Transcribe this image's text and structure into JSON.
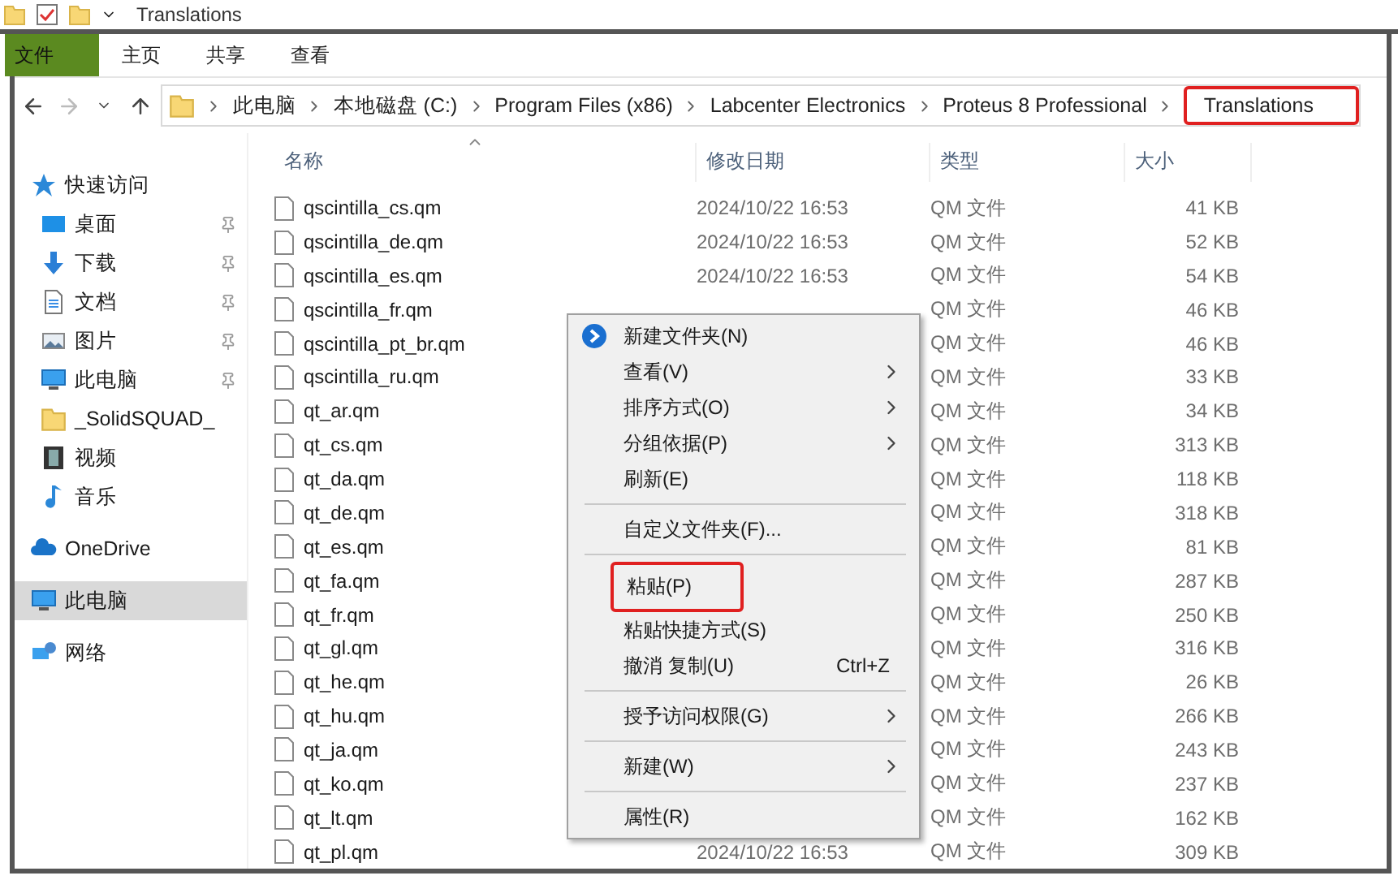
{
  "window": {
    "title": "Translations"
  },
  "ribbon_tabs": [
    {
      "label": "文件",
      "selected": true
    },
    {
      "label": "主页",
      "selected": false
    },
    {
      "label": "共享",
      "selected": false
    },
    {
      "label": "查看",
      "selected": false
    }
  ],
  "breadcrumbs": [
    {
      "label": "此电脑",
      "highlighted": false
    },
    {
      "label": "本地磁盘 (C:)",
      "highlighted": false
    },
    {
      "label": "Program Files (x86)",
      "highlighted": false
    },
    {
      "label": "Labcenter Electronics",
      "highlighted": false
    },
    {
      "label": "Proteus 8 Professional",
      "highlighted": false
    },
    {
      "label": "Translations",
      "highlighted": true
    }
  ],
  "sidebar": {
    "items": [
      {
        "label": "快速访问",
        "kind": "star",
        "pinned": false,
        "selected": false,
        "children": [
          {
            "label": "桌面",
            "kind": "desktop",
            "pinned": true,
            "selected": false
          },
          {
            "label": "下载",
            "kind": "download",
            "pinned": true,
            "selected": false
          },
          {
            "label": "文档",
            "kind": "document",
            "pinned": true,
            "selected": false
          },
          {
            "label": "图片",
            "kind": "pictures",
            "pinned": true,
            "selected": false
          },
          {
            "label": "此电脑",
            "kind": "computer",
            "pinned": true,
            "selected": false
          },
          {
            "label": "_SolidSQUAD_",
            "kind": "folder",
            "pinned": false,
            "selected": false
          },
          {
            "label": "视频",
            "kind": "video",
            "pinned": false,
            "selected": false
          },
          {
            "label": "音乐",
            "kind": "music",
            "pinned": false,
            "selected": false
          }
        ]
      },
      {
        "label": "OneDrive",
        "kind": "cloud",
        "pinned": false,
        "selected": false
      },
      {
        "label": "此电脑",
        "kind": "computer",
        "pinned": false,
        "selected": true
      },
      {
        "label": "网络",
        "kind": "network",
        "pinned": false,
        "selected": false
      }
    ]
  },
  "table": {
    "columns": [
      "名称",
      "修改日期",
      "类型",
      "大小"
    ],
    "rows": [
      {
        "name": "qscintilla_cs.qm",
        "date": "2024/10/22 16:53",
        "type": "QM 文件",
        "size": "41 KB"
      },
      {
        "name": "qscintilla_de.qm",
        "date": "2024/10/22 16:53",
        "type": "QM 文件",
        "size": "52 KB"
      },
      {
        "name": "qscintilla_es.qm",
        "date": "2024/10/22 16:53",
        "type": "QM 文件",
        "size": "54 KB"
      },
      {
        "name": "qscintilla_fr.qm",
        "type": "QM 文件",
        "size": "46 KB"
      },
      {
        "name": "qscintilla_pt_br.qm",
        "type": "QM 文件",
        "size": "46 KB"
      },
      {
        "name": "qscintilla_ru.qm",
        "type": "QM 文件",
        "size": "33 KB"
      },
      {
        "name": "qt_ar.qm",
        "type": "QM 文件",
        "size": "34 KB"
      },
      {
        "name": "qt_cs.qm",
        "type": "QM 文件",
        "size": "313 KB"
      },
      {
        "name": "qt_da.qm",
        "type": "QM 文件",
        "size": "118 KB"
      },
      {
        "name": "qt_de.qm",
        "type": "QM 文件",
        "size": "318 KB"
      },
      {
        "name": "qt_es.qm",
        "type": "QM 文件",
        "size": "81 KB"
      },
      {
        "name": "qt_fa.qm",
        "type": "QM 文件",
        "size": "287 KB"
      },
      {
        "name": "qt_fr.qm",
        "type": "QM 文件",
        "size": "250 KB"
      },
      {
        "name": "qt_gl.qm",
        "type": "QM 文件",
        "size": "316 KB"
      },
      {
        "name": "qt_he.qm",
        "type": "QM 文件",
        "size": "26 KB"
      },
      {
        "name": "qt_hu.qm",
        "type": "QM 文件",
        "size": "266 KB"
      },
      {
        "name": "qt_ja.qm",
        "type": "QM 文件",
        "size": "243 KB"
      },
      {
        "name": "qt_ko.qm",
        "type": "QM 文件",
        "size": "237 KB"
      },
      {
        "name": "qt_lt.qm",
        "type": "QM 文件",
        "size": "162 KB"
      },
      {
        "name": "qt_pl.qm",
        "date": "2024/10/22 16:53",
        "type": "QM 文件",
        "size": "309 KB"
      }
    ]
  },
  "context_menu": {
    "groups": [
      [
        {
          "label": "新建文件夹(N)",
          "kind": "with-icon",
          "submenu": false,
          "highlighted": false
        },
        {
          "label": "查看(V)",
          "kind": "plain",
          "submenu": true,
          "highlighted": false
        },
        {
          "label": "排序方式(O)",
          "kind": "plain",
          "submenu": true,
          "highlighted": false
        },
        {
          "label": "分组依据(P)",
          "kind": "plain",
          "submenu": true,
          "highlighted": false
        },
        {
          "label": "刷新(E)",
          "kind": "plain",
          "submenu": false,
          "highlighted": false
        }
      ],
      [
        {
          "label": "自定义文件夹(F)...",
          "kind": "plain",
          "submenu": false,
          "highlighted": false
        }
      ],
      [
        {
          "label": "粘贴(P)",
          "kind": "plain",
          "submenu": false,
          "highlighted": true
        },
        {
          "label": "粘贴快捷方式(S)",
          "kind": "plain",
          "submenu": false,
          "highlighted": false
        },
        {
          "label": "撤消 复制(U)",
          "kind": "plain",
          "submenu": false,
          "highlighted": false,
          "shortcut": "Ctrl+Z"
        }
      ],
      [
        {
          "label": "授予访问权限(G)",
          "kind": "plain",
          "submenu": true,
          "highlighted": false
        }
      ],
      [
        {
          "label": "新建(W)",
          "kind": "plain",
          "submenu": true,
          "highlighted": false
        }
      ],
      [
        {
          "label": "属性(R)",
          "kind": "plain",
          "submenu": false,
          "highlighted": false
        }
      ]
    ]
  }
}
